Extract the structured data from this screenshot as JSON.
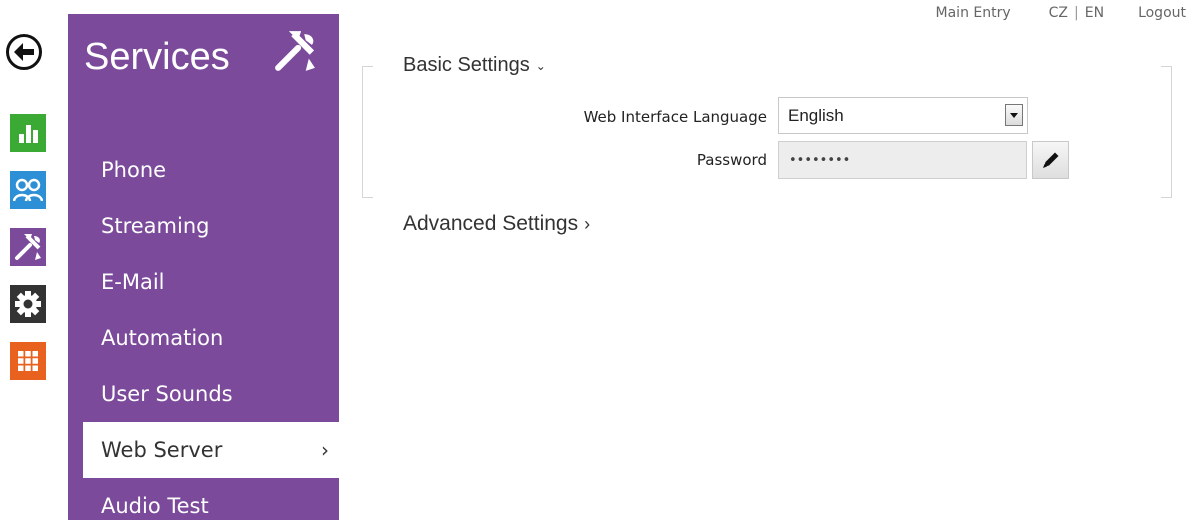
{
  "topnav": {
    "main_entry": "Main Entry",
    "lang_cz": "CZ",
    "lang_separator": "|",
    "lang_en": "EN",
    "logout": "Logout"
  },
  "rail": {
    "back_icon": "arrow-left-icon",
    "tiles": [
      {
        "name": "status",
        "icon": "bar-chart-icon",
        "color": "#3aaa35"
      },
      {
        "name": "directory",
        "icon": "users-icon",
        "color": "#2d8fd5"
      },
      {
        "name": "services",
        "icon": "tools-icon",
        "color": "#7b4a9b"
      },
      {
        "name": "hardware",
        "icon": "gear-icon",
        "color": "#333333"
      },
      {
        "name": "system",
        "icon": "grid-icon",
        "color": "#e8611e"
      }
    ]
  },
  "sidebar": {
    "title": "Services",
    "title_icon": "tools-icon",
    "accent_color": "#7b4a9b",
    "items": [
      {
        "label": "Phone"
      },
      {
        "label": "Streaming"
      },
      {
        "label": "E-Mail"
      },
      {
        "label": "Automation"
      },
      {
        "label": "User Sounds"
      },
      {
        "label": "Web Server",
        "active": true,
        "chevron": "›"
      },
      {
        "label": "Audio Test"
      }
    ]
  },
  "basic_settings": {
    "title": "Basic Settings",
    "caret": "⌄",
    "language_label": "Web Interface Language",
    "language_value": "English",
    "password_label": "Password",
    "password_value": "••••••••",
    "edit_icon": "pencil-icon"
  },
  "advanced_settings": {
    "title": "Advanced Settings",
    "caret": "›"
  }
}
